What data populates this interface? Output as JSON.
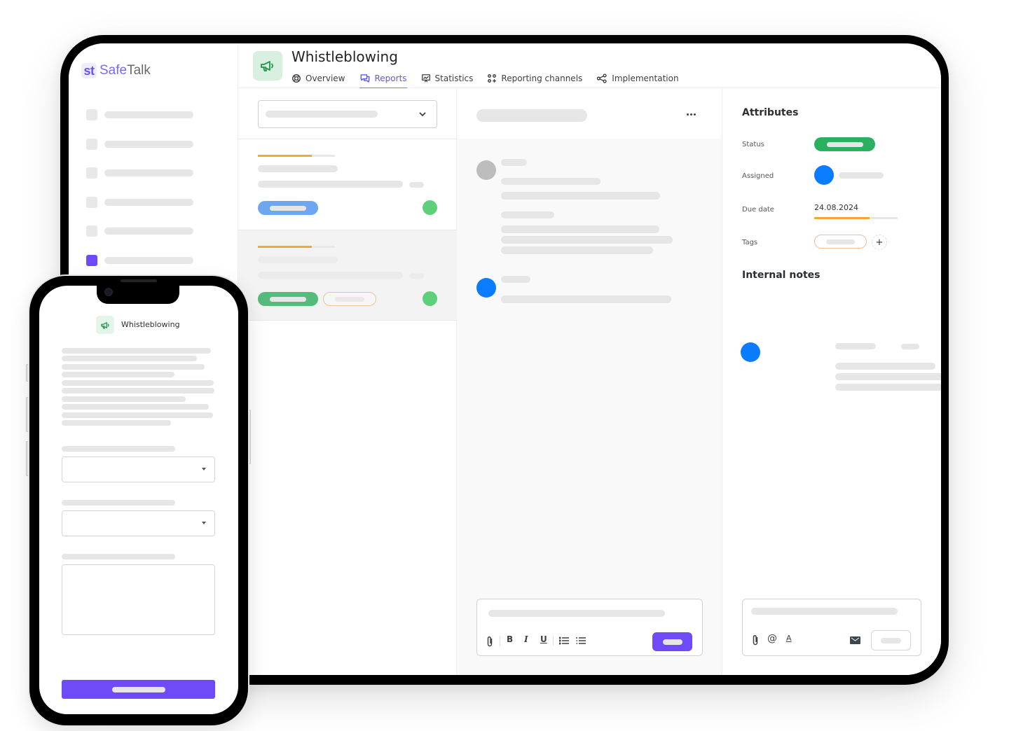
{
  "brand": {
    "prefix": "st",
    "name_a": "Safe",
    "name_b": "Talk"
  },
  "header": {
    "title": "Whistleblowing",
    "app_icon": "megaphone-icon",
    "tabs": [
      {
        "label": "Overview",
        "icon": "lifebuoy-icon",
        "active": false
      },
      {
        "label": "Reports",
        "icon": "chat-bubbles-icon",
        "active": true
      },
      {
        "label": "Statistics",
        "icon": "presentation-chart-icon",
        "active": false
      },
      {
        "label": "Reporting channels",
        "icon": "grid-plus-icon",
        "active": false
      },
      {
        "label": "Implementation",
        "icon": "share-nodes-icon",
        "active": false
      }
    ]
  },
  "sidebar": {
    "item_count": 6,
    "active_index": 5
  },
  "report_list": {
    "items": [
      {
        "progress": 0.7,
        "status_color": "#6ea7f0",
        "has_tag": false,
        "indicator_color": "#5ecf7a",
        "selected": false
      },
      {
        "progress": 0.7,
        "status_color": "#55bb7d",
        "has_tag": true,
        "indicator_color": "#5ecf7a",
        "selected": true
      }
    ]
  },
  "conversation": {
    "more_icon": "more-horizontal-icon",
    "composer_tools": [
      "paperclip-icon",
      "bold-icon",
      "italic-icon",
      "underline-icon",
      "bullet-list-icon",
      "numbered-list-icon"
    ],
    "tool_glyphs": {
      "bold": "B",
      "italic": "I",
      "underline": "U"
    }
  },
  "attributes": {
    "heading": "Attributes",
    "status_label": "Status",
    "assigned_label": "Assigned",
    "due_date_label": "Due date",
    "due_date_value": "24.08.2024",
    "due_progress": 0.66,
    "tags_label": "Tags",
    "add_tag": "+",
    "status_color": "#2ab05f",
    "assignee_color": "#0a7cff"
  },
  "internal_notes": {
    "heading": "Internal notes",
    "tools": [
      "paperclip-icon",
      "at-sign-icon",
      "text-color-icon",
      "envelope-icon"
    ],
    "at_glyph": "@",
    "text_glyph": "A"
  },
  "mobile": {
    "title": "Whistleblowing",
    "app_icon": "megaphone-icon",
    "fields": [
      "dropdown",
      "dropdown",
      "textarea"
    ]
  },
  "colors": {
    "accent": "#6e4bf7",
    "progress": "#f5a733",
    "blue": "#0a7cff",
    "green": "#2ab05f"
  }
}
